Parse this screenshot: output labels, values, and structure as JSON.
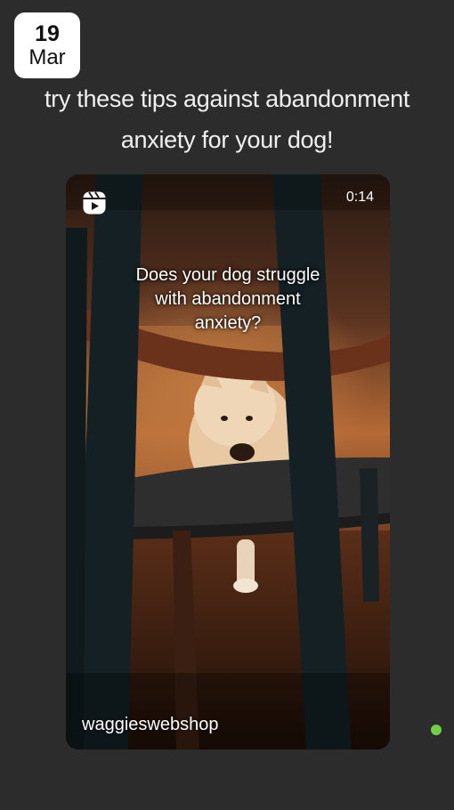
{
  "date_badge": {
    "day": "19",
    "month": "Mar"
  },
  "caption": {
    "line1": "try these tips against abandonment",
    "line2": "anxiety for your dog!"
  },
  "reel": {
    "icon": "reels-icon",
    "duration": "0:14",
    "overlay_line1": "Does your dog struggle",
    "overlay_line2": "with abandonment",
    "overlay_line3": "anxiety?",
    "author": "waggieswebshop"
  },
  "status": {
    "online_color": "#6fcf47"
  }
}
